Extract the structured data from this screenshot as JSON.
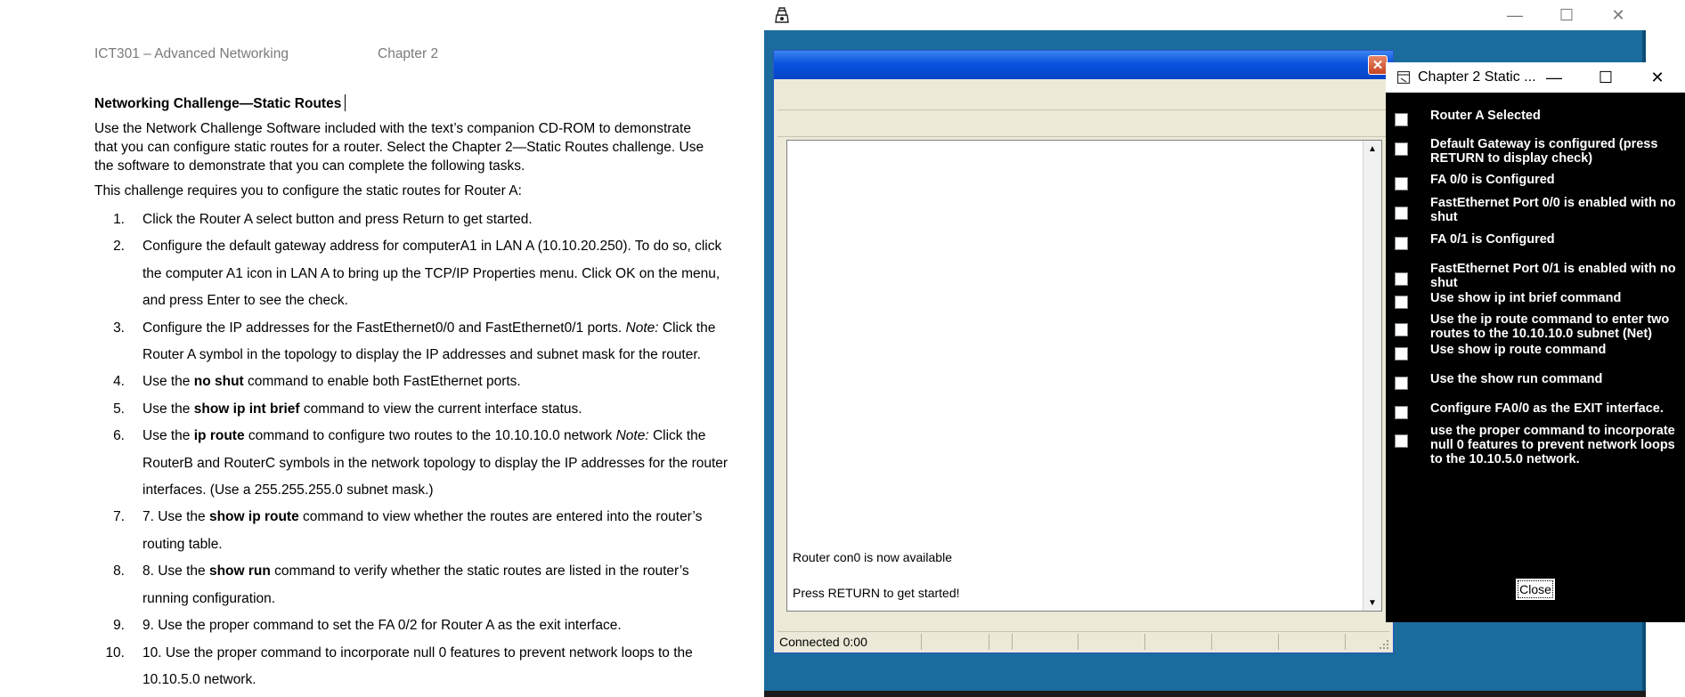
{
  "document": {
    "header_left": "ICT301 – Advanced Networking",
    "header_right": "Chapter 2",
    "title": "Networking Challenge—Static Routes",
    "intro": "Use the Network Challenge Software included with the text’s companion CD-ROM to demonstrate that you can configure static routes for a router. Select the Chapter 2—Static Routes challenge. Use the software to demonstrate that you can complete the following tasks.",
    "lead": "This challenge requires you to configure the static routes for Router A:",
    "steps": [
      {
        "num": "1.",
        "parts": [
          "Click the Router A select button and press Return to get started."
        ]
      },
      {
        "num": "2.",
        "parts": [
          "Configure the default gateway address for computerA1 in LAN A (10.10.20.250). To do so, click the computer A1 icon in LAN A to bring up the TCP/IP Properties menu. Click OK on the menu, and press Enter to see the check."
        ]
      },
      {
        "num": "3.",
        "parts": [
          "Configure the IP addresses for the FastEthernet0/0 and FastEthernet0/1 ports. ",
          "Note:",
          " Click the Router A symbol in the topology to display the IP addresses and subnet mask for the router."
        ]
      },
      {
        "num": "4.",
        "parts": [
          "Use the ",
          "no shut",
          " command to enable both FastEthernet ports."
        ]
      },
      {
        "num": "5.",
        "parts": [
          "Use the ",
          "show ip int brief",
          " command to view the current interface status."
        ]
      },
      {
        "num": "6.",
        "parts": [
          "Use the ",
          "ip route",
          " command to configure two routes to the 10.10.10.0 network ",
          "Note:",
          " Click the RouterB and RouterC symbols in the network topology to display the IP addresses for the router interfaces. (Use a 255.255.255.0 subnet mask.)"
        ]
      },
      {
        "num": "7.",
        "parts": [
          "7. Use the ",
          "show ip route",
          " command to view whether the routes are entered into the router’s routing table."
        ]
      },
      {
        "num": "8.",
        "parts": [
          "8. Use the ",
          "show run",
          " command to verify whether the static routes are listed in the router’s running configuration."
        ]
      },
      {
        "num": "9.",
        "parts": [
          "9. Use the proper command to set the FA 0/2 for Router A as the exit interface."
        ]
      },
      {
        "num": "10.",
        "parts": [
          "10. Use the proper command to incorporate null 0 features to prevent network loops to the 10.10.5.0 network."
        ]
      }
    ]
  },
  "outer_window": {
    "icon": "app-icon",
    "minimize": "—",
    "maximize": "☐",
    "close": "✕"
  },
  "terminal": {
    "close": "✕",
    "line1": "Router con0 is now available",
    "line2": "Press RETURN to get started!",
    "scroll_up": "▲",
    "scroll_down": "▼",
    "status": "Connected 0:00"
  },
  "checklist": {
    "title": "Chapter 2 Static ...",
    "minimize": "—",
    "maximize": "☐",
    "close": "✕",
    "items": [
      "Router A Selected",
      "Default Gateway is configured (press RETURN to display check)",
      "FA 0/0 is Configured",
      "FastEthernet Port 0/0 is enabled with no shut",
      "FA 0/1 is Configured",
      "FastEthernet Port 0/1 is enabled with no shut",
      "Use show ip int brief command",
      "Use the ip route command to enter two routes to the 10.10.10.0 subnet (Net)",
      "Use show ip route command",
      "Use the show run command",
      "Configure FA0/0 as the EXIT interface.",
      "use the proper command to incorporate null 0 features to prevent network loops to the 10.10.5.0 network."
    ],
    "close_button": "Close"
  }
}
